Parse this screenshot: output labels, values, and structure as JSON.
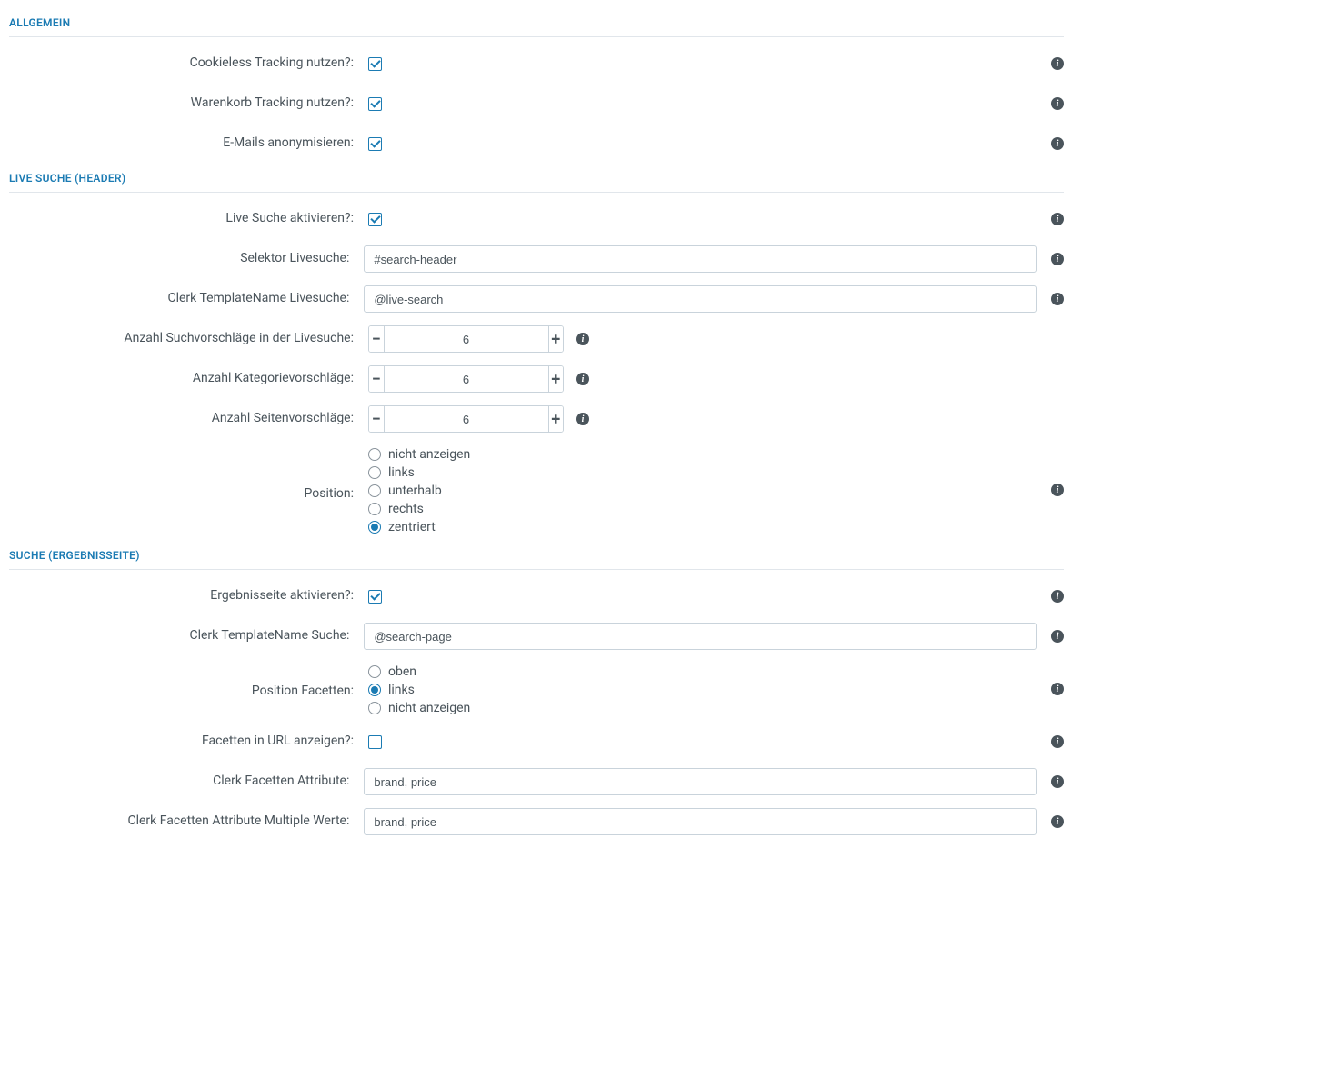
{
  "sections": {
    "allgemein": {
      "title": "ALLGEMEIN",
      "cookieless_label": "Cookieless Tracking nutzen?:",
      "cookieless_checked": true,
      "cart_label": "Warenkorb Tracking nutzen?:",
      "cart_checked": true,
      "anon_label": "E-Mails anonymisieren:",
      "anon_checked": true
    },
    "livesuche": {
      "title": "LIVE SUCHE (HEADER)",
      "enable_label": "Live Suche aktivieren?:",
      "enable_checked": true,
      "selector_label": "Selektor Livesuche:",
      "selector_value": "#search-header",
      "template_label": "Clerk TemplateName Livesuche:",
      "template_value": "@live-search",
      "sugg_label": "Anzahl Suchvorschläge in der Livesuche:",
      "sugg_value": "6",
      "cat_label": "Anzahl Kategorievorschläge:",
      "cat_value": "6",
      "page_label": "Anzahl Seitenvorschläge:",
      "page_value": "6",
      "pos_label": "Position:",
      "pos_options": [
        {
          "label": "nicht anzeigen",
          "selected": false
        },
        {
          "label": "links",
          "selected": false
        },
        {
          "label": "unterhalb",
          "selected": false
        },
        {
          "label": "rechts",
          "selected": false
        },
        {
          "label": "zentriert",
          "selected": true
        }
      ]
    },
    "suche": {
      "title": "SUCHE (ERGEBNISSEITE)",
      "enable_label": "Ergebnisseite aktivieren?:",
      "enable_checked": true,
      "template_label": "Clerk TemplateName Suche:",
      "template_value": "@search-page",
      "facet_pos_label": "Position Facetten:",
      "facet_pos_options": [
        {
          "label": "oben",
          "selected": false
        },
        {
          "label": "links",
          "selected": true
        },
        {
          "label": "nicht anzeigen",
          "selected": false
        }
      ],
      "facet_url_label": "Facetten in URL anzeigen?:",
      "facet_url_checked": false,
      "facet_attr_label": "Clerk Facetten Attribute:",
      "facet_attr_value": "brand, price",
      "facet_multi_label": "Clerk Facetten Attribute Multiple Werte:",
      "facet_multi_value": "brand, price"
    }
  }
}
